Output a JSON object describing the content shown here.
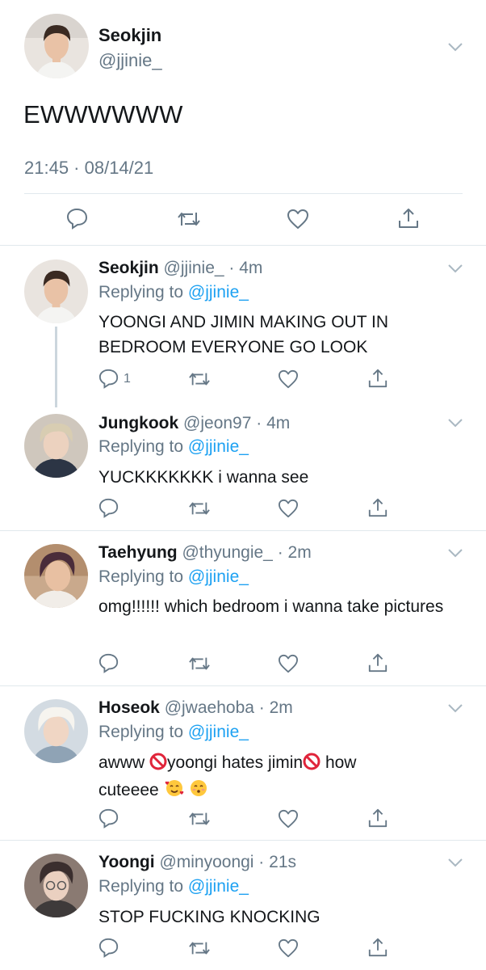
{
  "main_tweet": {
    "name": "Seokjin",
    "handle": "@jjinie_",
    "text": "EWWWWWW",
    "timestamp": "21:45 · 08/14/21",
    "actions": [
      "reply-icon",
      "retweet-icon",
      "like-icon",
      "share-icon"
    ]
  },
  "replies": [
    {
      "name": "Seokjin",
      "meta": "@jjinie_ · 4m",
      "replying_prefix": "Replying to ",
      "replying_to": "@jjinie_",
      "text": "YOONGI AND JIMIN MAKING OUT IN BEDROOM EVERYONE GO LOOK",
      "reply_count": "1"
    },
    {
      "name": "Jungkook",
      "meta": "@jeon97 · 4m",
      "replying_prefix": "Replying to ",
      "replying_to": "@jjinie_",
      "text": "YUCKKKKKKK i wanna see"
    },
    {
      "name": "Taehyung",
      "meta": "@thyungie_ · 2m",
      "replying_prefix": "Replying to ",
      "replying_to": "@jjinie_",
      "text": "omg!!!!!! which bedroom i wanna take pictures"
    },
    {
      "name": "Hoseok",
      "meta": "@jwaehoba · 2m",
      "replying_prefix": "Replying to ",
      "replying_to": "@jjinie_",
      "text_a": "awww ",
      "text_b": "yoongi hates jimin",
      "text_c": " how",
      "text_d": "cuteeee ",
      "emojis": [
        "prohibited-emoji",
        "smiling-face-with-hearts-emoji",
        "kissing-face-emoji"
      ]
    },
    {
      "name": "Yoongi",
      "meta": "@minyoongi · 21s",
      "replying_prefix": "Replying to ",
      "replying_to": "@jjinie_",
      "text": "STOP FUCKING KNOCKING"
    }
  ],
  "colors": {
    "text": "#14171a",
    "secondary": "#657786",
    "link": "#1da1f2",
    "divider": "#e1e8ed"
  }
}
